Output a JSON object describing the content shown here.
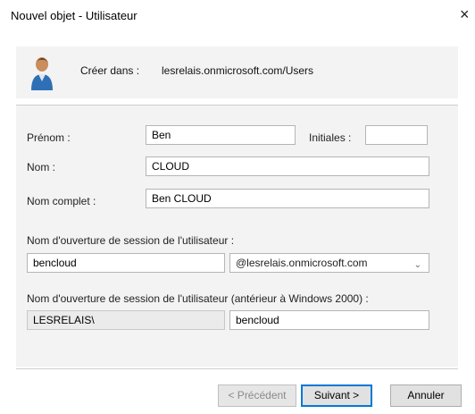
{
  "window": {
    "title": "Nouvel objet - Utilisateur",
    "close_glyph": "×"
  },
  "header": {
    "create_in_label": "Créer dans :",
    "create_in_value": "lesrelais.onmicrosoft.com/Users"
  },
  "form": {
    "first_name": {
      "label": "Prénom :",
      "value": "Ben"
    },
    "initials": {
      "label": "Initiales :",
      "value": ""
    },
    "last_name": {
      "label": "Nom :",
      "value": "CLOUD"
    },
    "full_name": {
      "label": "Nom complet :",
      "value": "Ben CLOUD"
    },
    "logon_name": {
      "label": "Nom d'ouverture de session de l'utilisateur :",
      "value": "bencloud",
      "domain_selected": "@lesrelais.onmicrosoft.com"
    },
    "pre_2000_logon": {
      "label": "Nom d'ouverture de session de l'utilisateur (antérieur à Windows 2000) :",
      "domain_prefix": "LESRELAIS\\",
      "value": "bencloud"
    }
  },
  "buttons": {
    "back": "< Précédent",
    "next": "Suivant >",
    "cancel": "Annuler"
  },
  "icons": {
    "user": "user-icon",
    "close": "close-icon",
    "dropdown": "chevron-down-icon"
  }
}
